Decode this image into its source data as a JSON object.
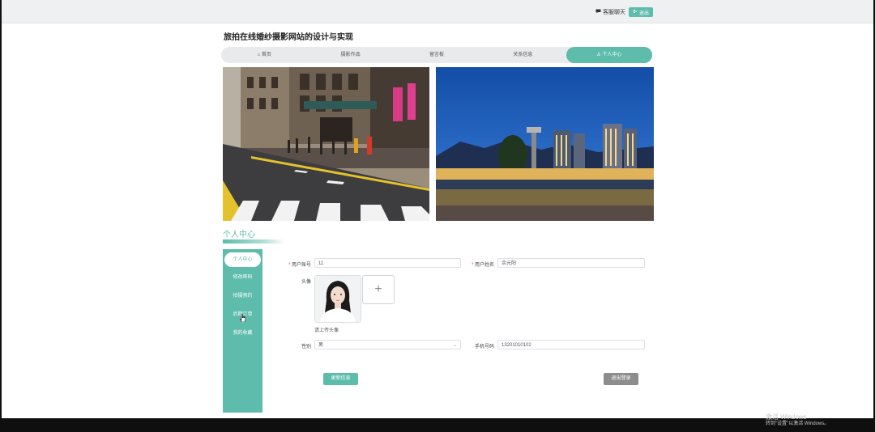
{
  "topbar": {
    "chat_label": "客服聊天",
    "exit_label": "退出",
    "chat_icon": "chat-bubble-icon",
    "exit_icon": "logout-icon"
  },
  "site": {
    "title": "旅拍在线婚纱摄影网站的设计与实现"
  },
  "nav": {
    "items": [
      {
        "label": "首页",
        "icon": "home-icon"
      },
      {
        "label": "摄影作品"
      },
      {
        "label": "留言板"
      },
      {
        "label": "关系信息"
      },
      {
        "label": "个人中心",
        "icon": "user-icon",
        "active": true
      }
    ]
  },
  "banner": {
    "left": "street-photo",
    "right": "night-city-photo"
  },
  "section": {
    "title": "个人中心"
  },
  "sidebar": {
    "items": [
      {
        "label": "个人中心",
        "active": true
      },
      {
        "label": "修改密码"
      },
      {
        "label": "拍摄预约"
      },
      {
        "label": "后期订单"
      },
      {
        "label": "我的收藏"
      }
    ]
  },
  "form": {
    "account_label": "用户账号",
    "account_value": "11",
    "name_label": "用户姓名",
    "name_value": "余元阳",
    "avatar_label": "头像",
    "upload_plus": "+",
    "upload_tip": "请上传头像",
    "gender_label": "性别",
    "gender_value": "男",
    "phone_label": "手机号码",
    "phone_value": "13201010102",
    "required_mark": "*"
  },
  "buttons": {
    "update_label": "更新信息",
    "logout_label": "退出登录"
  },
  "watermark": {
    "line1": "激活 Windows",
    "line2": "转到\"设置\"以激活 Windows。"
  },
  "colors": {
    "accent": "#5dbcac",
    "logout_button": "#8d8d8d",
    "required": "#e0524b"
  }
}
